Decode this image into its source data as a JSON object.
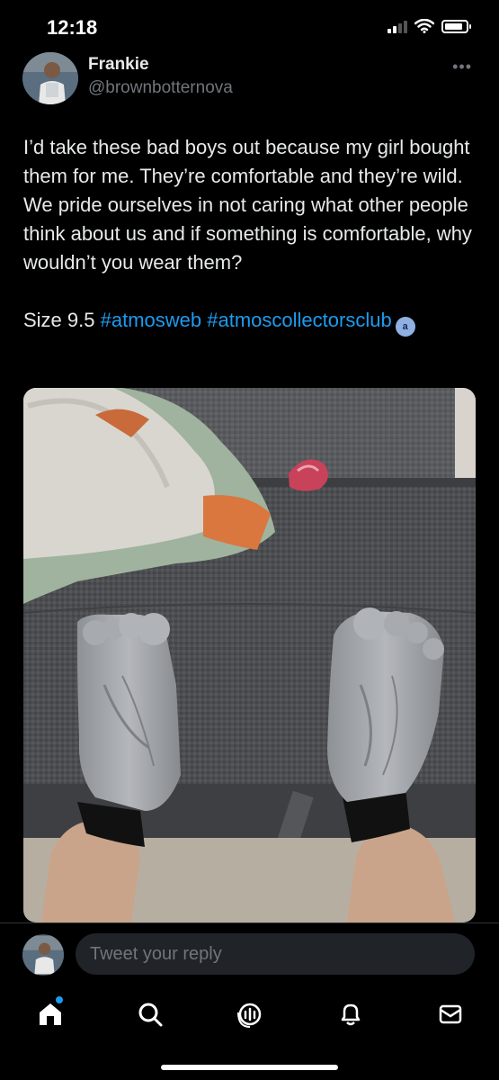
{
  "status_bar": {
    "time": "12:18",
    "battery_level": 0.85,
    "signal_bars": 4,
    "signal_bars_filled": 2
  },
  "tweet": {
    "author_name": "Frankie",
    "author_handle": "@brownbotternova",
    "body": "I’d take these bad boys out because my girl bought them for me. They’re comfortable and they’re wild. We pride ourselves in not caring what other people think about us and if something is comfortable, why wouldn’t you wear them?",
    "size_text": "Size 9.5",
    "hashtags": [
      "#atmosweb",
      "#atmoscollectorsclub"
    ],
    "badge_letter": "a"
  },
  "reply": {
    "placeholder": "Tweet your reply"
  },
  "nav": {
    "items": [
      "home-icon",
      "search-icon",
      "spaces-icon",
      "notifications-icon",
      "messages-icon"
    ],
    "has_home_notification": true
  },
  "colors": {
    "accent": "#1d9bf0",
    "background": "#000000",
    "text": "#e7e9ea",
    "muted": "#71767b"
  }
}
